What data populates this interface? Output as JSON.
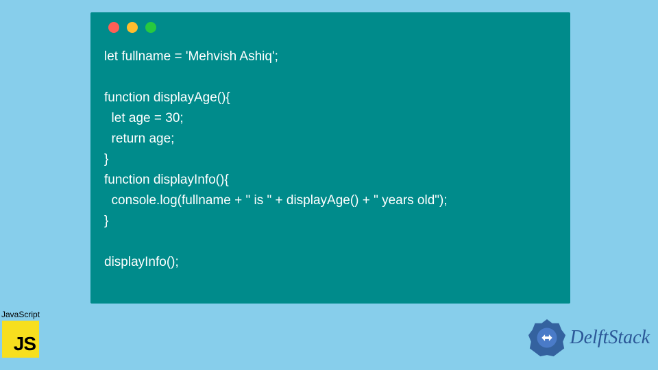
{
  "code": {
    "lines": "let fullname = 'Mehvish Ashiq';\n\nfunction displayAge(){\n  let age = 30;\n  return age;\n}\nfunction displayInfo(){\n  console.log(fullname + \" is \" + displayAge() + \" years old\");\n}\n\ndisplayInfo();"
  },
  "jsbadge": {
    "label": "JavaScript",
    "logo": "JS"
  },
  "brand": {
    "name": "DelftStack"
  }
}
